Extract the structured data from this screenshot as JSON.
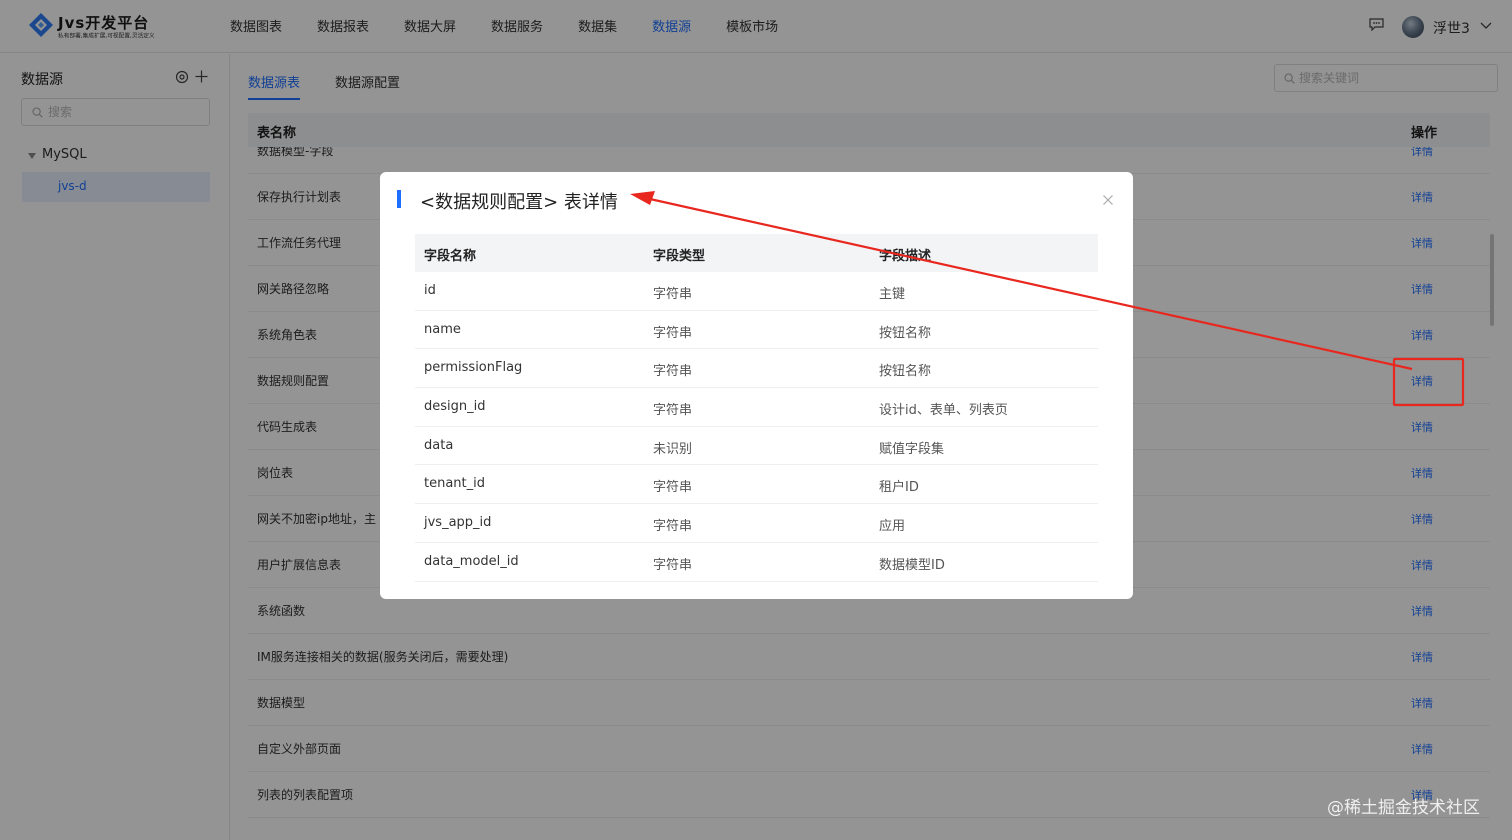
{
  "header": {
    "logo_title": "Jvs开发平台",
    "logo_subtitle": "私有部署,集成扩展,可视配置,灵活定义",
    "nav": [
      {
        "label": "数据图表"
      },
      {
        "label": "数据报表"
      },
      {
        "label": "数据大屏"
      },
      {
        "label": "数据服务"
      },
      {
        "label": "数据集"
      },
      {
        "label": "数据源",
        "active": true
      },
      {
        "label": "模板市场"
      }
    ],
    "username": "浮世3"
  },
  "sidebar": {
    "title": "数据源",
    "search_placeholder": "搜索",
    "tree_root": "MySQL",
    "tree_child": "jvs-d"
  },
  "main": {
    "tabs": [
      "数据源表",
      "数据源配置"
    ],
    "active_tab": "数据源表",
    "search_placeholder": "搜索关键词",
    "columns": {
      "name": "表名称",
      "action": "操作"
    },
    "link_label": "详情",
    "rows": [
      "数据模型-字段",
      "保存执行计划表",
      "工作流任务代理",
      "网关路径忽略",
      "系统角色表",
      "数据规则配置",
      "代码生成表",
      "岗位表",
      "网关不加密ip地址，主",
      "用户扩展信息表",
      "系统函数",
      "IM服务连接相关的数据(服务关闭后，需要处理)",
      "数据模型",
      "自定义外部页面",
      "列表的列表配置项"
    ]
  },
  "modal": {
    "title": "<数据规则配置> 表详情",
    "columns": [
      "字段名称",
      "字段类型",
      "字段描述"
    ],
    "rows": [
      [
        "id",
        "字符串",
        "主键"
      ],
      [
        "name",
        "字符串",
        "按钮名称"
      ],
      [
        "permissionFlag",
        "字符串",
        "按钮名称"
      ],
      [
        "design_id",
        "字符串",
        "设计id、表单、列表页"
      ],
      [
        "data",
        "未识别",
        "赋值字段集"
      ],
      [
        "tenant_id",
        "字符串",
        "租户ID"
      ],
      [
        "jvs_app_id",
        "字符串",
        "应用"
      ],
      [
        "data_model_id",
        "字符串",
        "数据模型ID"
      ]
    ]
  },
  "watermark": "@稀土掘金技术社区",
  "colors": {
    "accent": "#1e6fff",
    "annotation": "#e8271f",
    "mask": "rgba(0,0,0,0.42)"
  },
  "icons": [
    "logo-icon",
    "message-icon",
    "chevron-down-icon",
    "gear-icon",
    "plus-icon",
    "search-icon",
    "caret-down-icon",
    "close-icon"
  ]
}
